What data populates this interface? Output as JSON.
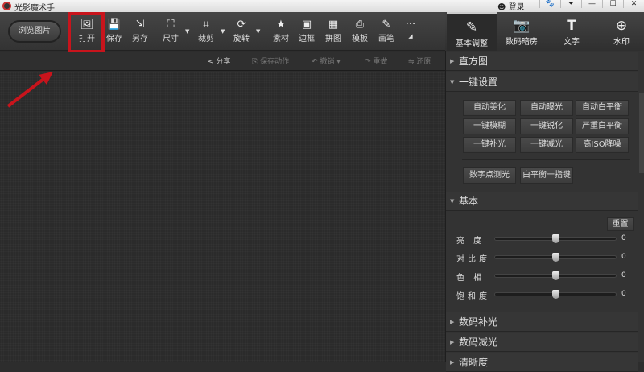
{
  "app": {
    "title": "光影魔术手",
    "login": "登录"
  },
  "window_controls": [
    "🐾",
    "⏷",
    "—",
    "☐",
    "✕"
  ],
  "toolbar": {
    "browse": "浏览图片",
    "items": [
      {
        "label": "打开",
        "icon": "open-icon",
        "glyph": "🖼"
      },
      {
        "label": "保存",
        "icon": "save-icon",
        "glyph": "💾"
      },
      {
        "label": "另存",
        "icon": "save-as-icon",
        "glyph": "⇲"
      },
      {
        "label": "尺寸",
        "icon": "resize-icon",
        "glyph": "⛶"
      },
      {
        "label": "裁剪",
        "icon": "crop-icon",
        "glyph": "⌗"
      },
      {
        "label": "旋转",
        "icon": "rotate-icon",
        "glyph": "⟳"
      },
      {
        "label": "素材",
        "icon": "material-icon",
        "glyph": "★"
      },
      {
        "label": "边框",
        "icon": "border-icon",
        "glyph": "▣"
      },
      {
        "label": "拼图",
        "icon": "collage-icon",
        "glyph": "▦"
      },
      {
        "label": "模板",
        "icon": "template-icon",
        "glyph": "⎙"
      },
      {
        "label": "画笔",
        "icon": "brush-icon",
        "glyph": "✎"
      },
      {
        "label": "",
        "icon": "more-icon",
        "glyph": "···"
      }
    ]
  },
  "subbar": {
    "share": "分享",
    "save_action": "保存动作",
    "undo": "撤销",
    "redo": "重做",
    "restore": "还原"
  },
  "tabs": [
    {
      "label": "基本调整",
      "glyph": "✎"
    },
    {
      "label": "数码暗房",
      "glyph": "📷"
    },
    {
      "label": "文字",
      "glyph": "T"
    },
    {
      "label": "水印",
      "glyph": "⊕"
    }
  ],
  "panel": {
    "histogram": "直方图",
    "one_click": "一键设置",
    "one_click_buttons": [
      "自动美化",
      "自动曝光",
      "自动白平衡",
      "一键模糊",
      "一键锐化",
      "严重白平衡",
      "一键补光",
      "一键减光",
      "高ISO降噪"
    ],
    "extra_buttons": [
      "数字点测光",
      "白平衡一指键"
    ],
    "basic": "基本",
    "reset": "重置",
    "sliders": [
      {
        "label": "亮 度",
        "value": 0
      },
      {
        "label": "对比度",
        "value": 0
      },
      {
        "label": "色 相",
        "value": 0
      },
      {
        "label": "饱和度",
        "value": 0
      }
    ],
    "sections": [
      "数码补光",
      "数码减光",
      "清晰度"
    ]
  }
}
